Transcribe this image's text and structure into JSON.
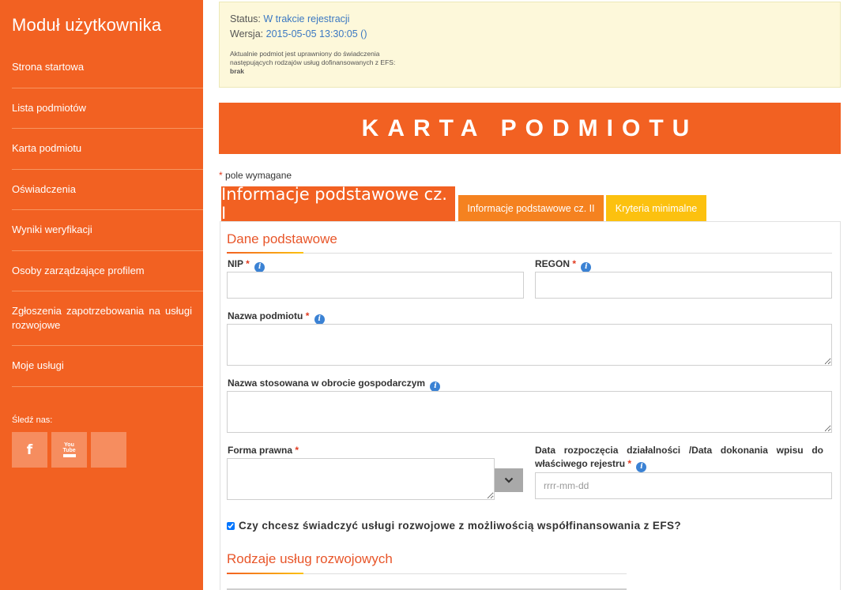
{
  "sidebar": {
    "title": "Moduł użytkownika",
    "items": [
      {
        "label": "Strona startowa"
      },
      {
        "label": "Lista podmiotów"
      },
      {
        "label": "Karta podmiotu"
      },
      {
        "label": "Oświadczenia"
      },
      {
        "label": "Wyniki weryfikacji"
      },
      {
        "label": "Osoby zarządzające profilem"
      },
      {
        "label": "Zgłoszenia zapotrzebowania na usługi rozwojowe"
      },
      {
        "label": "Moje usługi"
      }
    ],
    "follow_label": "Śledź nas:",
    "social": [
      {
        "icon": "facebook-icon",
        "glyph": "f"
      },
      {
        "icon": "youtube-icon",
        "glyph": "You Tube"
      },
      {
        "icon": "social-placeholder-icon",
        "glyph": ""
      }
    ]
  },
  "status": {
    "status_label": "Status:",
    "status_value": "W trakcie rejestracji",
    "version_label": "Wersja:",
    "version_value": "2015-05-05 13:30:05 ()",
    "note": "Aktualnie podmiot jest uprawniony do świadczenia następujących rodzajów usług dofinansowanych z EFS:",
    "note_value": "brak"
  },
  "banner": {
    "title": "KARTA PODMIOTU"
  },
  "required_note": {
    "star": "*",
    "text": "pole wymagane"
  },
  "tabs": [
    {
      "label": "Informacje podstawowe cz. I"
    },
    {
      "label": "Informacje podstawowe cz. II"
    },
    {
      "label": "Kryteria minimalne"
    }
  ],
  "form": {
    "section_basic": "Dane podstawowe",
    "nip_label": "NIP",
    "regon_label": "REGON",
    "name_label": "Nazwa podmiotu",
    "trade_name_label": "Nazwa stosowana w obrocie gospodarczym",
    "legal_form_label": "Forma prawna",
    "start_date_label": "Data rozpoczęcia działalności /Data dokonania wpisu do właściwego rejestru",
    "start_date_placeholder": "rrrr-mm-dd",
    "required_star": "*",
    "info_glyph": "i",
    "efs_question": "Czy chcesz świadczyć usługi rozwojowe z możliwością współfinansowania z EFS?",
    "efs_checked": true,
    "section_services": "Rodzaje usług rozwojowych"
  },
  "colors": {
    "brand_orange": "#f26122",
    "tab_orange": "#f58220",
    "tab_yellow": "#fcc10f",
    "status_bg": "#fdf8da",
    "link_blue": "#3b78c2",
    "info_blue": "#3b82d4"
  }
}
